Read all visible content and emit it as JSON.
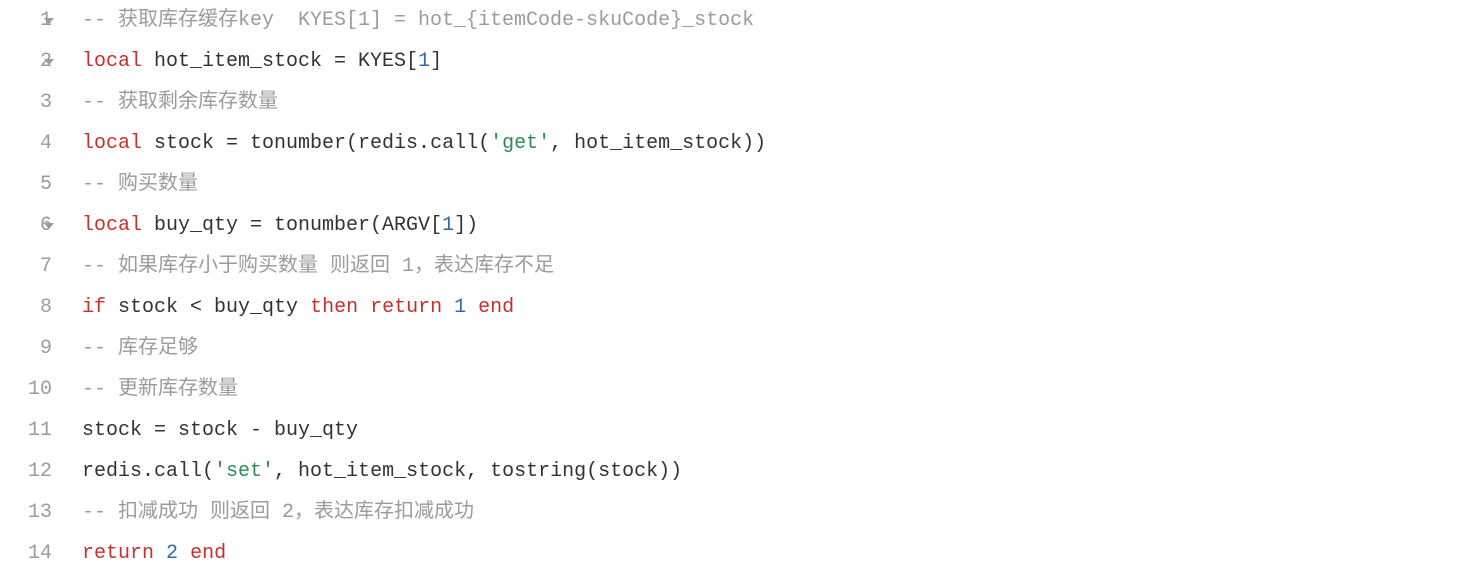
{
  "lines": [
    {
      "num": "1",
      "fold": true,
      "tokens": [
        {
          "cls": "comment",
          "t": "-- 获取库存缓存key  KYES[1] = hot_{itemCode-skuCode}_stock"
        }
      ]
    },
    {
      "num": "2",
      "fold": true,
      "tokens": [
        {
          "cls": "keyword",
          "t": "local"
        },
        {
          "cls": "identifier",
          "t": " hot_item_stock = KYES["
        },
        {
          "cls": "number",
          "t": "1"
        },
        {
          "cls": "identifier",
          "t": "]"
        }
      ]
    },
    {
      "num": "3",
      "fold": false,
      "tokens": [
        {
          "cls": "comment",
          "t": "-- 获取剩余库存数量"
        }
      ]
    },
    {
      "num": "4",
      "fold": false,
      "tokens": [
        {
          "cls": "keyword",
          "t": "local"
        },
        {
          "cls": "identifier",
          "t": " stock = tonumber(redis.call("
        },
        {
          "cls": "string",
          "t": "'get'"
        },
        {
          "cls": "identifier",
          "t": ", hot_item_stock))"
        }
      ]
    },
    {
      "num": "5",
      "fold": false,
      "tokens": [
        {
          "cls": "comment",
          "t": "-- 购买数量"
        }
      ]
    },
    {
      "num": "6",
      "fold": true,
      "tokens": [
        {
          "cls": "keyword",
          "t": "local"
        },
        {
          "cls": "identifier",
          "t": " buy_qty = tonumber(ARGV["
        },
        {
          "cls": "number",
          "t": "1"
        },
        {
          "cls": "identifier",
          "t": "])"
        }
      ]
    },
    {
      "num": "7",
      "fold": false,
      "tokens": [
        {
          "cls": "comment",
          "t": "-- 如果库存小于购买数量 则返回 1，表达库存不足"
        }
      ]
    },
    {
      "num": "8",
      "fold": false,
      "tokens": [
        {
          "cls": "keyword",
          "t": "if"
        },
        {
          "cls": "identifier",
          "t": " stock < buy_qty "
        },
        {
          "cls": "keyword",
          "t": "then"
        },
        {
          "cls": "identifier",
          "t": " "
        },
        {
          "cls": "keyword",
          "t": "return"
        },
        {
          "cls": "identifier",
          "t": " "
        },
        {
          "cls": "number",
          "t": "1"
        },
        {
          "cls": "identifier",
          "t": " "
        },
        {
          "cls": "keyword",
          "t": "end"
        }
      ]
    },
    {
      "num": "9",
      "fold": false,
      "tokens": [
        {
          "cls": "comment",
          "t": "-- 库存足够"
        }
      ]
    },
    {
      "num": "10",
      "fold": false,
      "tokens": [
        {
          "cls": "comment",
          "t": "-- 更新库存数量"
        }
      ]
    },
    {
      "num": "11",
      "fold": false,
      "tokens": [
        {
          "cls": "identifier",
          "t": "stock = stock - buy_qty"
        }
      ]
    },
    {
      "num": "12",
      "fold": false,
      "tokens": [
        {
          "cls": "identifier",
          "t": "redis.call("
        },
        {
          "cls": "string",
          "t": "'set'"
        },
        {
          "cls": "identifier",
          "t": ", hot_item_stock, tostring(stock))"
        }
      ]
    },
    {
      "num": "13",
      "fold": false,
      "tokens": [
        {
          "cls": "comment",
          "t": "-- 扣减成功 则返回 2，表达库存扣减成功"
        }
      ]
    },
    {
      "num": "14",
      "fold": false,
      "tokens": [
        {
          "cls": "keyword",
          "t": "return"
        },
        {
          "cls": "identifier",
          "t": " "
        },
        {
          "cls": "number",
          "t": "2"
        },
        {
          "cls": "identifier",
          "t": " "
        },
        {
          "cls": "keyword",
          "t": "end"
        }
      ]
    }
  ]
}
